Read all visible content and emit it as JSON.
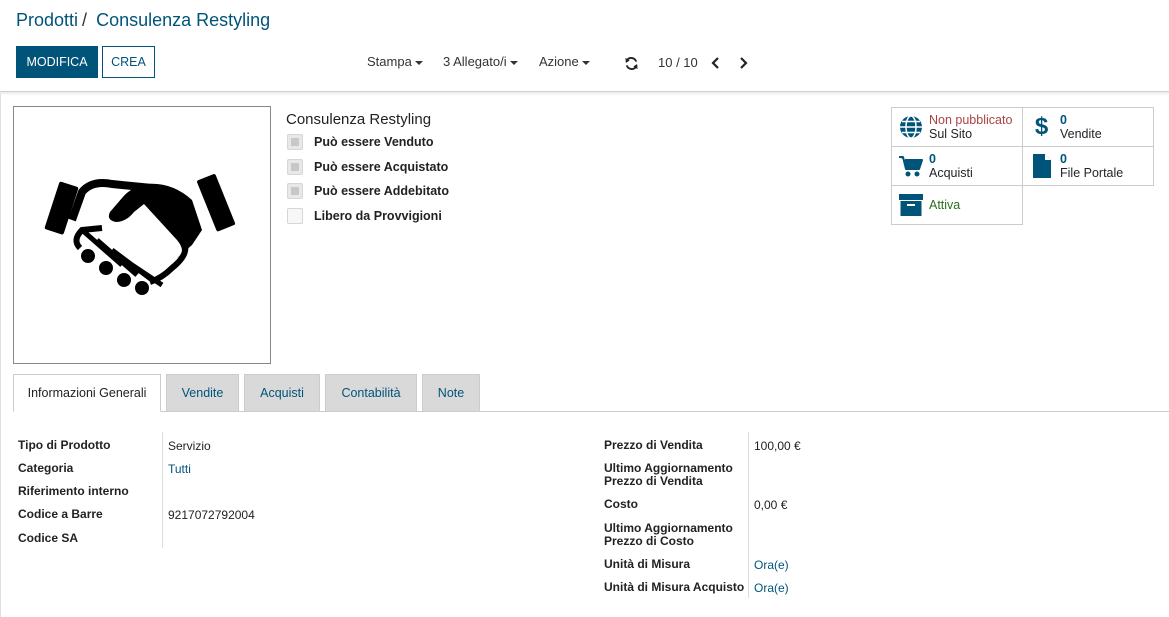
{
  "breadcrumb": {
    "parent": "Prodotti",
    "separator": "/",
    "current": "Consulenza Restyling"
  },
  "toolbar": {
    "edit_label": "MODIFICA",
    "create_label": "CREA",
    "print_label": "Stampa",
    "attachments_label": "3 Allegato/i",
    "action_label": "Azione",
    "pager_value": "10 / 10"
  },
  "product": {
    "name": "Consulenza Restyling",
    "image_icon": "handshake-icon",
    "checks": [
      {
        "label": "Può essere Venduto",
        "checked": true
      },
      {
        "label": "Può essere Acquistato",
        "checked": true
      },
      {
        "label": "Può essere Addebitato",
        "checked": true
      },
      {
        "label": "Libero da Provvigioni",
        "checked": false
      }
    ]
  },
  "smart_buttons": {
    "website": {
      "status": "Non pubblicato",
      "label": "Sul Sito",
      "icon": "globe-icon",
      "status_color": "#a94442"
    },
    "sales": {
      "count": "0",
      "label": "Vendite",
      "icon": "dollar-icon"
    },
    "purchases": {
      "count": "0",
      "label": "Acquisti",
      "icon": "cart-icon"
    },
    "portal_files": {
      "count": "0",
      "label": "File Portale",
      "icon": "file-icon"
    },
    "active": {
      "label": "Attiva",
      "icon": "archive-icon",
      "color": "#2a6f1e"
    }
  },
  "tabs": [
    {
      "label": "Informazioni Generali",
      "active": true
    },
    {
      "label": "Vendite",
      "active": false
    },
    {
      "label": "Acquisti",
      "active": false
    },
    {
      "label": "Contabilità",
      "active": false
    },
    {
      "label": "Note",
      "active": false
    }
  ],
  "left_fields": {
    "product_type": {
      "label": "Tipo di Prodotto",
      "value": "Servizio"
    },
    "category": {
      "label": "Categoria",
      "value": "Tutti"
    },
    "internal_ref": {
      "label": "Riferimento interno",
      "value": ""
    },
    "barcode": {
      "label": "Codice a Barre",
      "value": "9217072792004"
    },
    "sa_code": {
      "label": "Codice SA",
      "value": ""
    }
  },
  "right_fields": {
    "sale_price": {
      "label": "Prezzo di Vendita",
      "value": "100,00 €"
    },
    "sale_price_update": {
      "label_1": "Ultimo Aggiornamento",
      "label_2": "Prezzo di Vendita",
      "value": ""
    },
    "cost": {
      "label": "Costo",
      "value": "0,00 €"
    },
    "cost_update": {
      "label_1": "Ultimo Aggiornamento",
      "label_2": "Prezzo di Costo",
      "value": ""
    },
    "uom": {
      "label": "Unità di Misura",
      "value": "Ora(e)"
    },
    "purchase_uom": {
      "label": "Unità di Misura Acquisto",
      "value": "Ora(e)"
    }
  },
  "colors": {
    "brand": "#00547a"
  }
}
